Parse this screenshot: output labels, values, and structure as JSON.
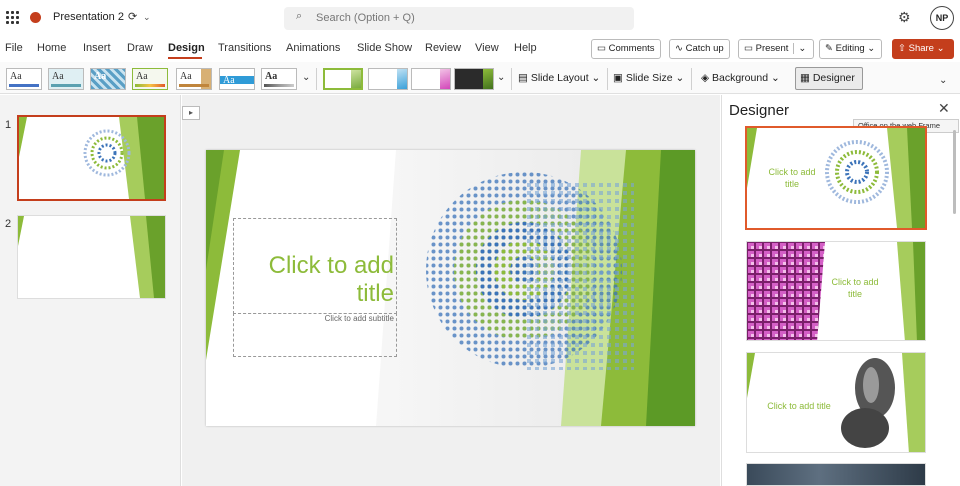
{
  "titlebar": {
    "doc_title": "Presentation 2",
    "search_placeholder": "Search (Option + Q)",
    "avatar_initials": "NP"
  },
  "menu": {
    "items": [
      "File",
      "Home",
      "Insert",
      "Draw",
      "Design",
      "Transitions",
      "Animations",
      "Slide Show",
      "Review",
      "View",
      "Help"
    ],
    "active": "Design"
  },
  "actions": {
    "comments": "Comments",
    "catch_up": "Catch up",
    "present": "Present",
    "editing": "Editing",
    "share": "Share"
  },
  "ribbon": {
    "theme_glyph": "Aa",
    "slide_layout": "Slide Layout",
    "slide_size": "Slide Size",
    "background": "Background",
    "designer": "Designer"
  },
  "slides": {
    "numbers": [
      "1",
      "2"
    ],
    "selected": 1
  },
  "slide": {
    "title": "Click to add title",
    "subtitle": "Click to add subtitle"
  },
  "designer": {
    "title": "Designer",
    "tooltip": "Office on the web Frame",
    "card_title": "Click to add title"
  },
  "colors": {
    "accent": "#c43e1c",
    "green": "#8dbb3a",
    "designer_selected": "#e05a2b"
  }
}
